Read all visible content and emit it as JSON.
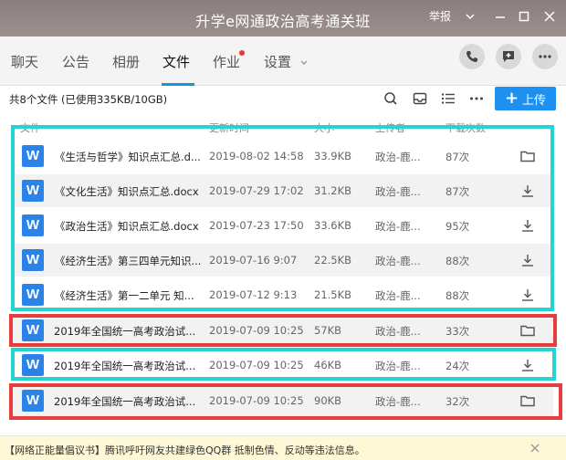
{
  "window": {
    "title": "升学e网通政治高考通关班",
    "report_label": "举报"
  },
  "nav": {
    "tabs": [
      {
        "label": "聊天"
      },
      {
        "label": "公告"
      },
      {
        "label": "相册"
      },
      {
        "label": "文件"
      },
      {
        "label": "作业"
      },
      {
        "label": "设置"
      }
    ],
    "active_tab": "文件"
  },
  "toolbar": {
    "summary": "共8个文件 (已使用335KB/10GB)",
    "upload_label": "上传"
  },
  "table": {
    "headers": [
      "文件",
      "更新时间",
      "大小",
      "上传者",
      "下载次数"
    ],
    "rows": [
      {
        "name": "《生活与哲学》知识点汇总.d...",
        "time": "2019-08-02 14:58",
        "size": "33.9KB",
        "uploader": "政治-鹿...",
        "downloads": "87次",
        "action": "folder-icon"
      },
      {
        "name": "《文化生活》知识点汇总.docx",
        "time": "2019-07-29 17:02",
        "size": "31.2KB",
        "uploader": "政治-鹿...",
        "downloads": "87次",
        "action": "download-icon"
      },
      {
        "name": "《政治生活》知识点汇总.docx",
        "time": "2019-07-23 17:50",
        "size": "33.6KB",
        "uploader": "政治-鹿...",
        "downloads": "95次",
        "action": "download-icon"
      },
      {
        "name": "《经济生活》第三四单元知识...",
        "time": "2019-07-16 9:07",
        "size": "22.5KB",
        "uploader": "政治-鹿...",
        "downloads": "88次",
        "action": "download-icon"
      },
      {
        "name": "《经济生活》第一二单元 知...",
        "time": "2019-07-12 9:13",
        "size": "21.5KB",
        "uploader": "政治-鹿...",
        "downloads": "88次",
        "action": "download-icon"
      },
      {
        "name": "2019年全国统一高考政治试...",
        "time": "2019-07-09 10:25",
        "size": "57KB",
        "uploader": "政治-鹿...",
        "downloads": "33次",
        "action": "folder-icon"
      },
      {
        "name": "2019年全国统一高考政治试...",
        "time": "2019-07-09 10:25",
        "size": "46KB",
        "uploader": "政治-鹿...",
        "downloads": "24次",
        "action": "download-icon"
      },
      {
        "name": "2019年全国统一高考政治试...",
        "time": "2019-07-09 10:25",
        "size": "90KB",
        "uploader": "政治-鹿...",
        "downloads": "32次",
        "action": "folder-icon"
      }
    ],
    "file_icon_letter": "W"
  },
  "notice": {
    "text": "【网络正能量倡议书】腾讯呼吁网友共建绿色QQ群 抵制色情、反动等违法信息。"
  },
  "colors": {
    "accent": "#1e90f0",
    "file_icon": "#2b83e8",
    "highlight_cyan": "#26d3d3",
    "highlight_red": "#e93c3c",
    "title_bar": "#9c908f"
  }
}
